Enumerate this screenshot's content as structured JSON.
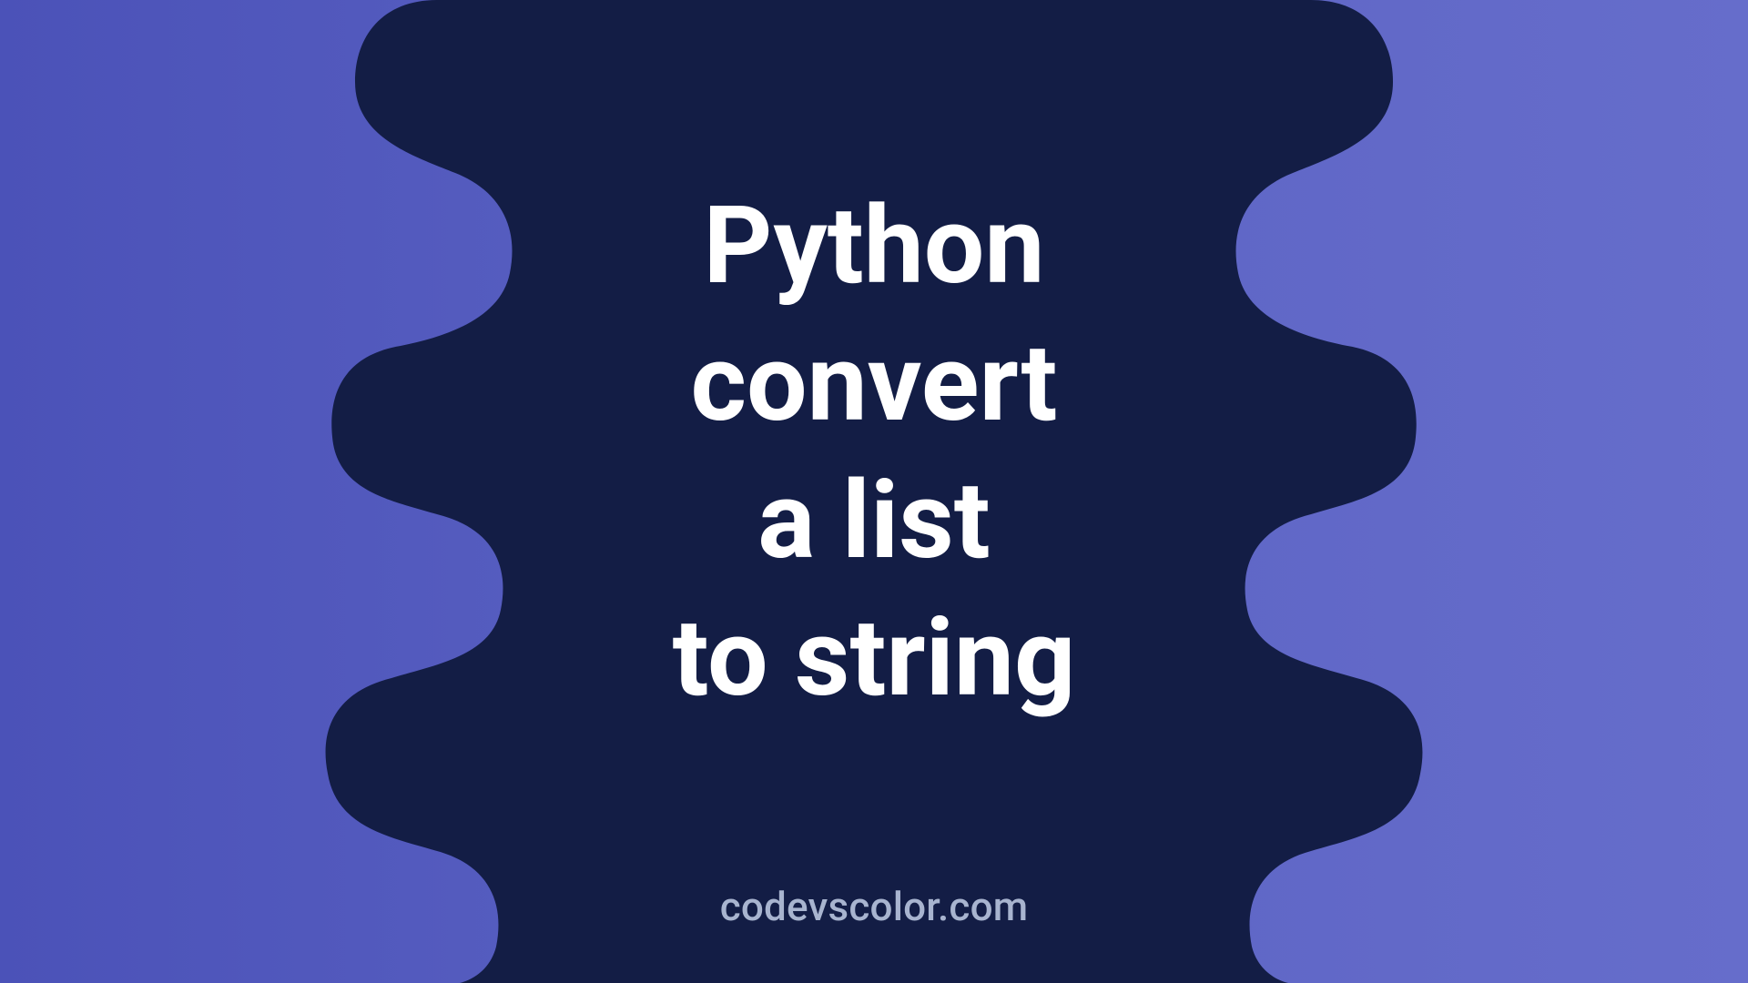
{
  "title_lines": "Python\nconvert\na list\nto string",
  "site": "codevscolor.com",
  "colors": {
    "bg_left": "#4b52b8",
    "bg_right": "#666dcb",
    "blob": "#131d45",
    "text": "#ffffff",
    "site": "#a8b4cf"
  }
}
